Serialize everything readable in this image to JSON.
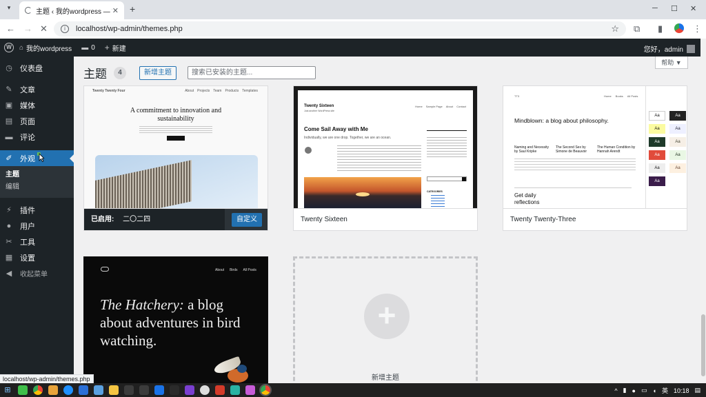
{
  "browser": {
    "tab_title": "主题 ‹ 我的wordpress — Wor",
    "url": "localhost/wp-admin/themes.php",
    "status_url": "localhost/wp-admin/themes.php"
  },
  "adminbar": {
    "site_name": "我的wordpress",
    "comments_count": "0",
    "new_label": "新建",
    "greeting": "您好，admin"
  },
  "sidebar": {
    "items": [
      {
        "label": "仪表盘",
        "icon": "dashboard-icon"
      },
      {
        "label": "文章",
        "icon": "pin-icon"
      },
      {
        "label": "媒体",
        "icon": "media-icon"
      },
      {
        "label": "页面",
        "icon": "page-icon"
      },
      {
        "label": "评论",
        "icon": "comment-icon"
      },
      {
        "label": "外观",
        "icon": "brush-icon"
      },
      {
        "label": "插件",
        "icon": "plugin-icon"
      },
      {
        "label": "用户",
        "icon": "user-icon"
      },
      {
        "label": "工具",
        "icon": "wrench-icon"
      },
      {
        "label": "设置",
        "icon": "settings-icon"
      }
    ],
    "submenu": [
      "主题",
      "编辑"
    ],
    "collapse_label": "收起菜单"
  },
  "page": {
    "title": "主题",
    "count": "4",
    "add_new_label": "新增主题",
    "search_placeholder": "搜索已安装的主题...",
    "help_label": "帮助 ▼"
  },
  "themes": [
    {
      "name": "二〇二四",
      "active_label": "已启用:",
      "customize_label": "自定义",
      "shot_headline": "A commitment to innovation and sustainability",
      "shot_brand": "Twenty Twenty Four",
      "shot_nav": [
        "About",
        "Projects",
        "Team",
        "Products",
        "Templates"
      ]
    },
    {
      "name": "Twenty Sixteen",
      "shot_brand": "Twenty Sixteen",
      "shot_tagline": "Just another WordPress site",
      "shot_headline": "Come Sail Away with Me",
      "shot_sub": "Individually, we are one drop. Together, we are an ocean.",
      "shot_nav": [
        "Home",
        "Sample Page",
        "About",
        "Contact"
      ],
      "shot_widget_title": "CATEGORIES"
    },
    {
      "name": "Twenty Twenty-Three",
      "shot_brand": "TT3",
      "shot_headline": "Mindblown: a blog about philosophy.",
      "shot_posts": [
        "Naming and Necessity by Saul Kripke",
        "The Second Sex by Simone de Beauvoir",
        "The Human Condition by Hannah Arendt"
      ],
      "shot_footer": "Get daily reflections",
      "shot_nav": [
        "Home",
        "Books",
        "All Posts"
      ],
      "swatch_label": "Aa"
    },
    {
      "name": "",
      "shot_headline_italic": "The Hatchery:",
      "shot_headline_rest": "a blog about adventures in bird watching.",
      "shot_nav": [
        "About",
        "Birds",
        "All Posts"
      ]
    }
  ],
  "add_new_theme_label": "新增主题",
  "taskbar": {
    "time": "10:18",
    "ime": "英"
  }
}
